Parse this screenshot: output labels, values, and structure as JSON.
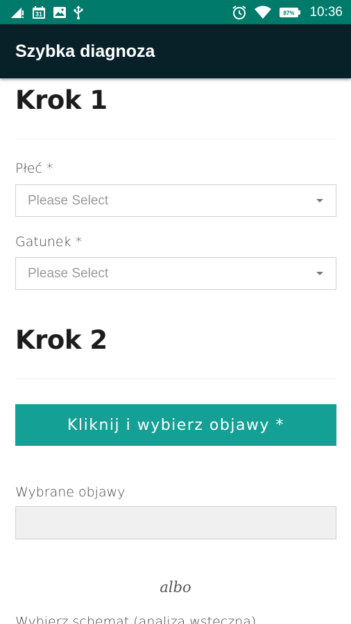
{
  "status_bar": {
    "calendar_day": "31",
    "battery_percent": "87%",
    "time": "10:36",
    "icons": [
      "signal-icon",
      "calendar-icon",
      "image-icon",
      "usb-icon",
      "alarm-icon",
      "wifi-icon",
      "battery-icon"
    ]
  },
  "app_bar": {
    "title": "Szybka diagnoza"
  },
  "step1": {
    "title": "Krok 1",
    "sex_label": "Płeć *",
    "sex_select": "Please Select",
    "species_label": "Gatunek *",
    "species_select": "Please Select"
  },
  "step2": {
    "title": "Krok 2",
    "symptoms_button": "Kliknij i wybierz objawy *",
    "selected_symptoms_label": "Wybrane objawy",
    "selected_symptoms_value": ""
  },
  "or_text": "albo",
  "scheme_label": "Wybierz schemat (analiza wsteczna)",
  "colors": {
    "status_bar": "#007a6b",
    "app_bar": "#082028",
    "accent": "#15a095",
    "readonly_bg": "#f0f0f0"
  }
}
